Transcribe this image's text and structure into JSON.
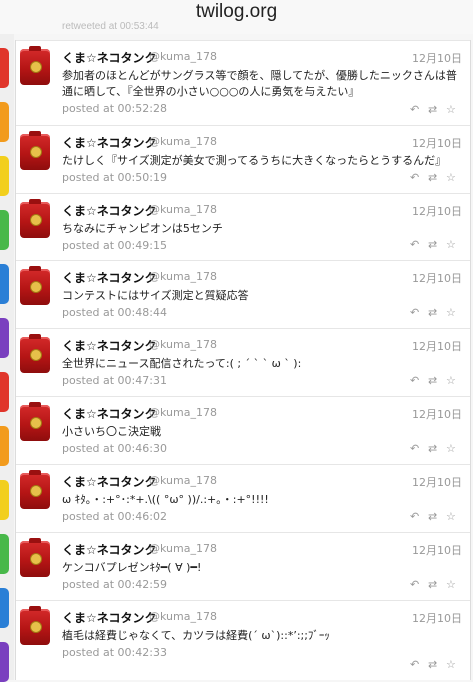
{
  "browser": {
    "title": "twilog.org"
  },
  "previous_snippet": "retweeted at 00:53:44",
  "sidebar_colors": [
    "#e0352b",
    "#f29b1d",
    "#f2cf1d",
    "#48b84a",
    "#2a7fd6",
    "#7a3fbf",
    "#e0352b",
    "#f29b1d",
    "#f2cf1d",
    "#48b84a",
    "#2a7fd6",
    "#7a3fbf"
  ],
  "icons": {
    "reply": "reply-icon",
    "retweet": "retweet-icon",
    "favorite": "star-icon"
  },
  "tweets": [
    {
      "name": "くま☆ネコタンク",
      "handle": "@kuma_178",
      "date": "12月10日",
      "text": "参加者のほとんどがサングラス等で顔を、隠してたが、優勝したニックさんは普通に晒して、『全世界の小さい○○○の人に勇気を与えたい』",
      "posted": "posted at 00:52:28"
    },
    {
      "name": "くま☆ネコタンク",
      "handle": "@kuma_178",
      "date": "12月10日",
      "text": "たけしく『サイズ測定が美女で測ってるうちに大きくなったらとうするんだ』",
      "posted": "posted at 00:50:19"
    },
    {
      "name": "くま☆ネコタンク",
      "handle": "@kuma_178",
      "date": "12月10日",
      "text": "ちなみにチャンピオンは5センチ",
      "posted": "posted at 00:49:15"
    },
    {
      "name": "くま☆ネコタンク",
      "handle": "@kuma_178",
      "date": "12月10日",
      "text": "コンテストにはサイズ測定と質疑応答",
      "posted": "posted at 00:48:44"
    },
    {
      "name": "くま☆ネコタンク",
      "handle": "@kuma_178",
      "date": "12月10日",
      "text": "全世界にニュース配信されたって:( ; ´ ` ` ω ` ):",
      "posted": "posted at 00:47:31"
    },
    {
      "name": "くま☆ネコタンク",
      "handle": "@kuma_178",
      "date": "12月10日",
      "text": "小さいち〇こ決定戦",
      "posted": "posted at 00:46:30"
    },
    {
      "name": "くま☆ネコタンク",
      "handle": "@kuma_178",
      "date": "12月10日",
      "text": "ω ｷﾀ｡・:+°･:*+.\\(( °ω° ))/.:+｡・:+°!!!!",
      "posted": "posted at 00:46:02"
    },
    {
      "name": "くま☆ネコタンク",
      "handle": "@kuma_178",
      "date": "12月10日",
      "text": "ケンコバプレゼンｷﾀ━( ∀ )━!",
      "posted": "posted at 00:42:59"
    },
    {
      "name": "くま☆ネコタンク",
      "handle": "@kuma_178",
      "date": "12月10日",
      "text": "植毛は経費じゃなくて、カツラは経費(´ ω`)::*’:;;ﾌﾞｰｯ",
      "posted": "posted at 00:42:33"
    }
  ]
}
